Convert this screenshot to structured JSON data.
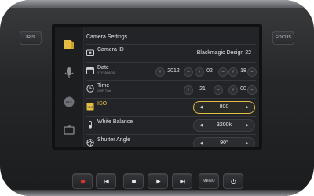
{
  "side_buttons": {
    "left": "IRIS",
    "right": "FOCUS"
  },
  "screen": {
    "title": "Camera Settings",
    "nav_icons": [
      "folder-icon",
      "microphone-icon",
      "record-icon",
      "tv-icon"
    ],
    "rows": [
      {
        "label": "Camera ID",
        "sublabel": "",
        "value": "Blackmagic Design 22",
        "icon": "camera-icon"
      },
      {
        "label": "Date",
        "sublabel": "YYYY/MM/DD",
        "year": "2012",
        "month": "02",
        "day": "18",
        "icon": "calendar-icon"
      },
      {
        "label": "Time",
        "sublabel": "24HR Time",
        "hours": "21",
        "minutes": "00",
        "icon": "clock-icon"
      },
      {
        "label": "ISO",
        "value": "800",
        "selected": true,
        "icon": "iso-icon"
      },
      {
        "label": "White Balance",
        "value": "3200k",
        "icon": "white-balance-icon"
      },
      {
        "label": "Shutter Angle",
        "value": "90°",
        "icon": "shutter-icon"
      }
    ],
    "symbols": {
      "plus": "+",
      "minus": "−",
      "left": "◀",
      "right": "▶"
    }
  },
  "controls": {
    "menu_label": "MENU"
  },
  "colors": {
    "accent": "#e3be45",
    "record": "#d9322b"
  }
}
